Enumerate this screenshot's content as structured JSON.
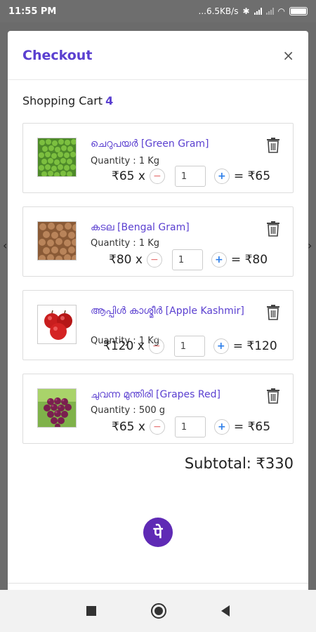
{
  "status_bar": {
    "time": "11:55 PM",
    "speed": "...6.5KB/s"
  },
  "modal": {
    "title": "Checkout",
    "close": "×"
  },
  "cart": {
    "label": "Shopping Cart",
    "count": "4"
  },
  "items": [
    {
      "name": "ചെറുപയർ [Green Gram]",
      "quantity": "Quantity : 1 Kg",
      "unit_price": "₹65 x",
      "qty": "1",
      "total": "= ₹65",
      "image": "green-gram"
    },
    {
      "name": "കടല [Bengal Gram]",
      "quantity": "Quantity : 1 Kg",
      "unit_price": "₹80 x",
      "qty": "1",
      "total": "= ₹80",
      "image": "bengal-gram"
    },
    {
      "name": "ആപ്പിൾ കാശ്മീർ [Apple Kashmir]",
      "quantity": "Quantity : 1 Kg",
      "unit_price": "₹120 x",
      "qty": "1",
      "total": "= ₹120",
      "image": "apple"
    },
    {
      "name": "ചുവന്ന മുന്തിരി [Grapes Red]",
      "quantity": "Quantity : 500 g",
      "unit_price": "₹65 x",
      "qty": "1",
      "total": "= ₹65",
      "image": "grapes"
    }
  ],
  "subtotal": "Subtotal: ₹330",
  "pay_button": {
    "glyph": "पे",
    "icon": "phonepe-icon"
  },
  "colors": {
    "accent": "#5a3fd0",
    "pay": "#5f2ab5"
  }
}
